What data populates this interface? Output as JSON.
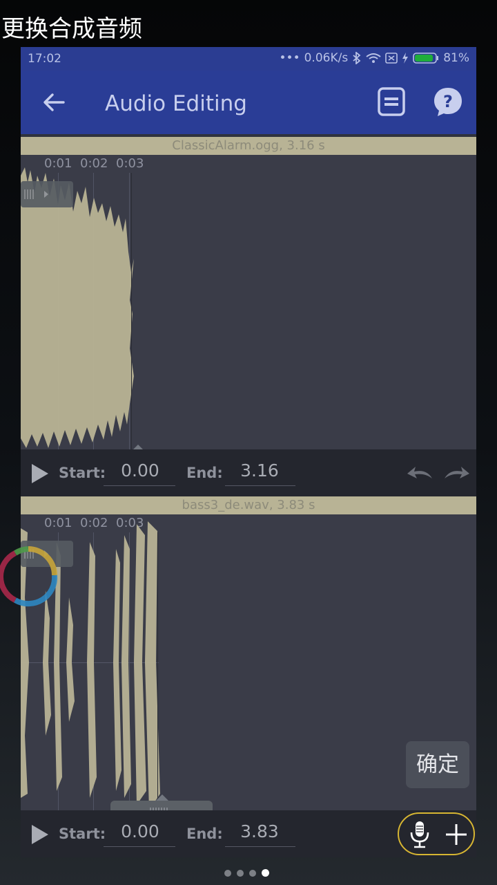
{
  "overlay": {
    "title": "更换合成音频",
    "confirm_label": "确定"
  },
  "statusbar": {
    "time": "17:02",
    "network_speed": "0.06K/s",
    "battery": "81%"
  },
  "appbar": {
    "title": "Audio Editing"
  },
  "track1": {
    "file_label": "ClassicAlarm.ogg, 3.16 s",
    "ticks": [
      "0:01",
      "0:02",
      "0:03"
    ],
    "start_label": "Start:",
    "start_value": "0.00",
    "end_label": "End:",
    "end_value": "3.16"
  },
  "track2": {
    "file_label": "bass3_de.wav, 3.83 s",
    "ticks": [
      "0:01",
      "0:02",
      "0:03"
    ],
    "start_label": "Start:",
    "start_value": "0.00",
    "end_label": "End:",
    "end_value": "3.83"
  },
  "pager": {
    "count": 4,
    "active": 3
  },
  "colors": {
    "appbar": "#2a3d96",
    "waveform": "#b8b395",
    "highlight": "#d7b632"
  },
  "icons": [
    "back-arrow-icon",
    "save-icon",
    "help-icon",
    "play-icon",
    "undo-icon",
    "redo-icon",
    "microphone-icon",
    "plus-icon",
    "loading-spinner-icon"
  ]
}
